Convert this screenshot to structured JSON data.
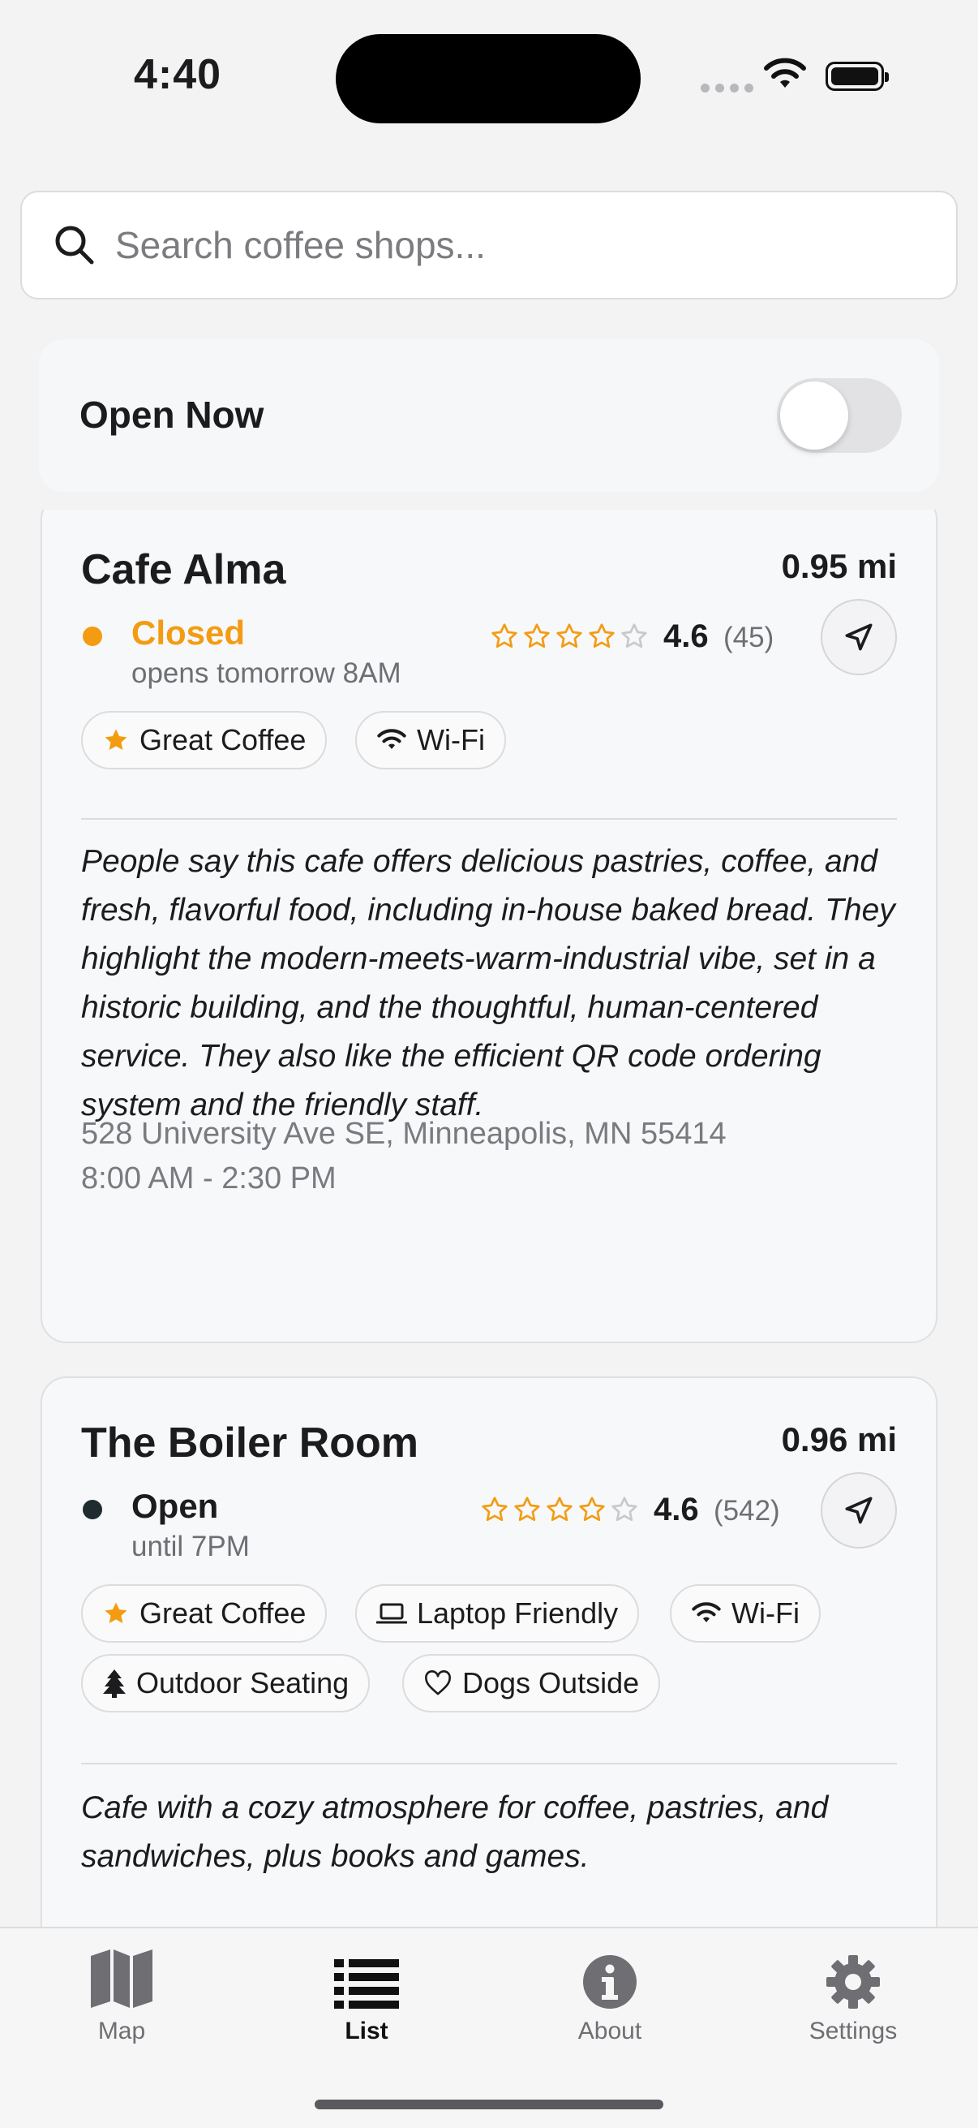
{
  "status_bar": {
    "time": "4:40"
  },
  "search": {
    "placeholder": "Search coffee shops..."
  },
  "filter": {
    "open_now_label": "Open Now",
    "open_now_enabled": false
  },
  "cafes": [
    {
      "name": "Cafe Alma",
      "distance": "0.95 mi",
      "status": "Closed",
      "status_detail": "opens tomorrow 8AM",
      "status_color": "#f39c12",
      "stars": 4,
      "rating": "4.6",
      "review_count": "(45)",
      "tags": [
        {
          "icon": "star-icon",
          "label": "Great Coffee"
        },
        {
          "icon": "wifi-icon",
          "label": "Wi-Fi"
        }
      ],
      "description": "People say this cafe offers delicious pastries, coffee, and fresh, flavorful food, including in-house baked bread. They highlight the modern-meets-warm-industrial vibe, set in a historic building, and the thoughtful, human-centered service. They also like the efficient QR code ordering system and the friendly staff.",
      "address": "528 University Ave SE, Minneapolis, MN 55414",
      "hours": "8:00 AM - 2:30 PM"
    },
    {
      "name": "The Boiler Room",
      "distance": "0.96 mi",
      "status": "Open",
      "status_detail": "until 7PM",
      "status_color": "#1f2b2e",
      "stars": 4,
      "rating": "4.6",
      "review_count": "(542)",
      "tags": [
        {
          "icon": "star-icon",
          "label": "Great Coffee"
        },
        {
          "icon": "laptop-icon",
          "label": "Laptop Friendly"
        },
        {
          "icon": "wifi-icon",
          "label": "Wi-Fi"
        },
        {
          "icon": "tree-icon",
          "label": "Outdoor Seating"
        },
        {
          "icon": "heart-icon",
          "label": "Dogs Outside"
        }
      ],
      "description": "Cafe with a cozy atmosphere for coffee, pastries, and sandwiches, plus books and games."
    }
  ],
  "tab_bar": {
    "active": "List",
    "items": [
      {
        "label": "Map",
        "icon": "map-icon"
      },
      {
        "label": "List",
        "icon": "list-icon"
      },
      {
        "label": "About",
        "icon": "info-icon"
      },
      {
        "label": "Settings",
        "icon": "gear-icon"
      }
    ]
  },
  "colors": {
    "accent": "#f39c12",
    "text": "#1c1c1e",
    "muted": "#6e6e73"
  }
}
